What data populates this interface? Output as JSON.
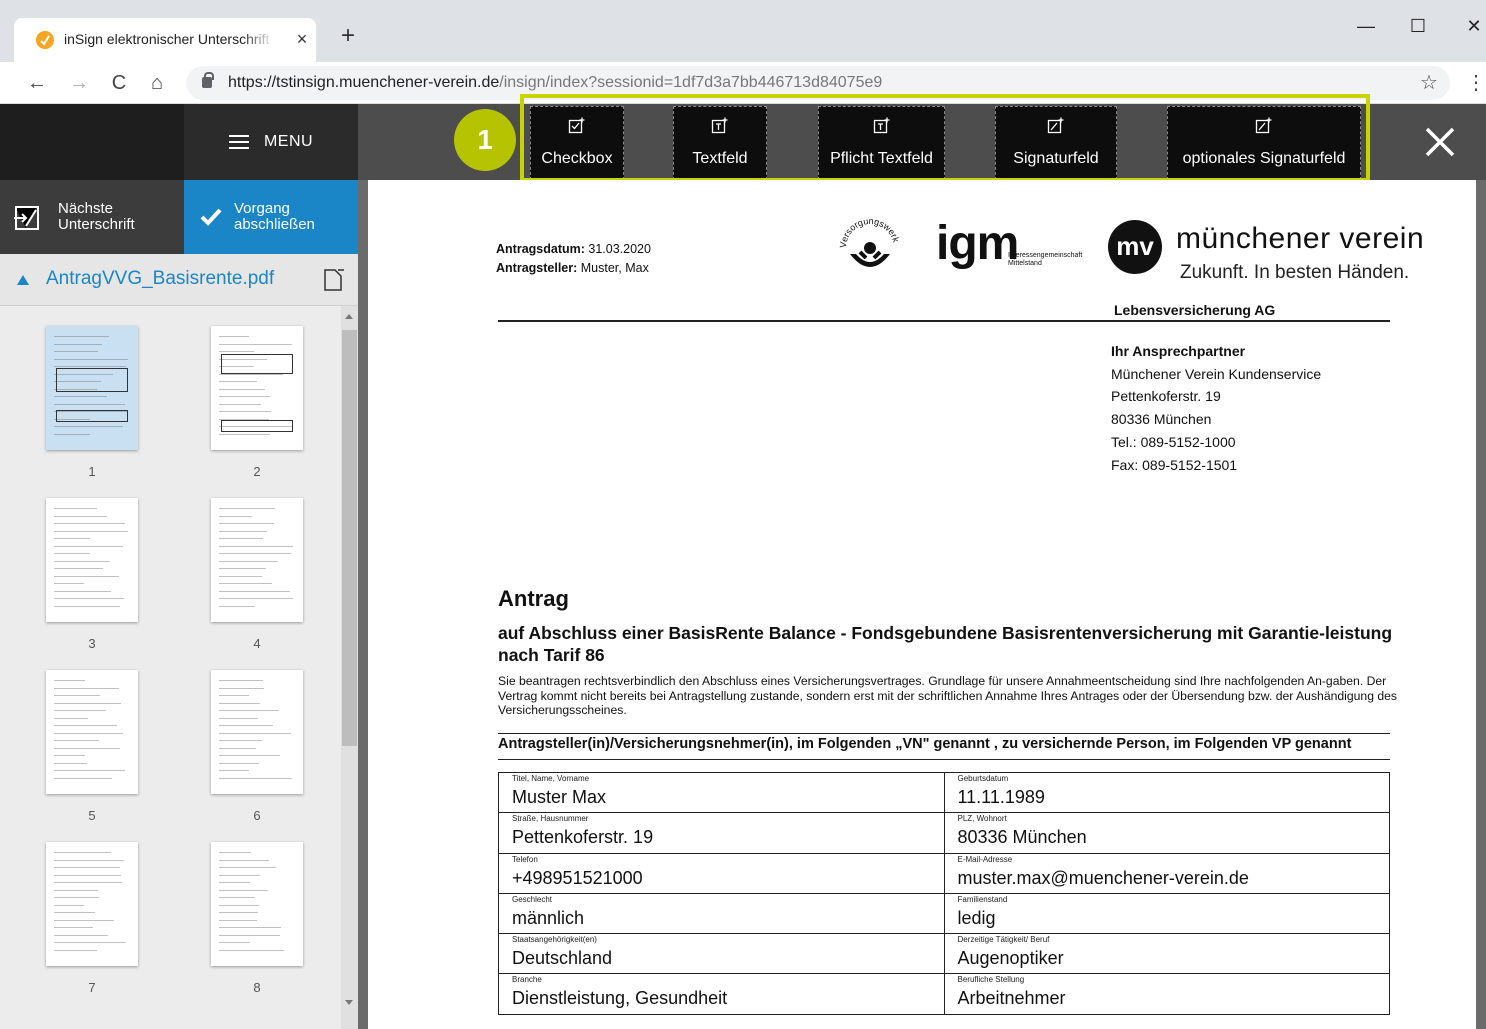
{
  "browser": {
    "tab_title": "inSign elektronischer Unterschrift",
    "tab_close": "×",
    "new_tab": "+",
    "url_host": "https://tstinsign.muenchener-verein.de",
    "url_path": "/insign/index?sessionid=1df7d3a7bb446713d84075e9",
    "nav": {
      "back": "←",
      "forward": "→",
      "reload": "C",
      "home": "⌂",
      "star": "☆",
      "more": "⋮"
    },
    "window": {
      "minimize": "—",
      "maximize": "☐",
      "close": "✕"
    }
  },
  "app": {
    "menu_label": "MENU",
    "next_signature": {
      "line1": "Nächste",
      "line2": "Unterschrift"
    },
    "finish": {
      "line1": "Vorgang",
      "line2": "abschließen"
    },
    "file_name": "AntragVVG_Basisrente.pdf",
    "accent_color": "#1a86c8",
    "highlight_color": "#c8d400",
    "badge_number": "1",
    "toolbar": [
      {
        "label": "Checkbox",
        "icon": "checkbox-add-icon"
      },
      {
        "label": "Textfeld",
        "icon": "textfield-add-icon"
      },
      {
        "label": "Pflicht Textfeld",
        "icon": "required-textfield-add-icon"
      },
      {
        "label": "Signaturfeld",
        "icon": "signature-field-add-icon"
      },
      {
        "label": "optionales Signaturfeld",
        "icon": "optional-signature-field-add-icon"
      }
    ],
    "thumbnails": {
      "pages": [
        "1",
        "2",
        "3",
        "4",
        "5",
        "6",
        "7",
        "8"
      ],
      "selected": "1"
    }
  },
  "document": {
    "date_label": "Antragsdatum:",
    "date_value": "31.03.2020",
    "applicant_label": "Antragsteller:",
    "applicant_value": "Muster, Max",
    "logo_vw_text": "Versorgungswerk",
    "logo_igm": "igm",
    "logo_igm_sub1": "Interessengemeinschaft",
    "logo_igm_sub2": "Mittelstand",
    "logo_mv_mark": "mv",
    "logo_mv_name": "münchener verein",
    "logo_mv_claim": "Zukunft. In besten Händen.",
    "company_unit": "Lebensversicherung AG",
    "contact": {
      "title": "Ihr Ansprechpartner",
      "lines": [
        "Münchener Verein Kundenservice",
        "Pettenkoferstr. 19",
        "80336 München",
        "Tel.: 089-5152-1000",
        "Fax: 089-5152-1501"
      ]
    },
    "title": "Antrag",
    "subtitle": "auf Abschluss einer BasisRente Balance - Fondsgebundene Basisrentenversicherung mit Garantie-leistung nach Tarif 86",
    "paragraph": "Sie beantragen rechtsverbindlich den Abschluss eines Versicherungsvertrages. Grundlage für unsere Annahmeentscheidung sind Ihre nachfolgenden An-gaben. Der Vertrag kommt nicht bereits bei Antragstellung zustande, sondern erst mit der schriftlichen Annahme Ihres Antrages oder der Übersendung bzw. der Aushändigung des Versicherungsscheines.",
    "section_heading": "Antragsteller(in)/Versicherungsnehmer(in), im Folgenden „VN\" genannt , zu versichernde Person, im Folgenden VP genannt",
    "form_rows": [
      [
        {
          "caption": "Titel, Name, Vorname",
          "value": "Muster Max"
        },
        {
          "caption": "Geburtsdatum",
          "value": "11.11.1989"
        }
      ],
      [
        {
          "caption": "Straße, Hausnummer",
          "value": "Pettenkoferstr. 19"
        },
        {
          "caption": "PLZ, Wohnort",
          "value": "80336 München"
        }
      ],
      [
        {
          "caption": "Telefon",
          "value": "+498951521000"
        },
        {
          "caption": "E-Mail-Adresse",
          "value": "muster.max@muenchener-verein.de"
        }
      ],
      [
        {
          "caption": "Geschlecht",
          "value": "männlich"
        },
        {
          "caption": "Familienstand",
          "value": "ledig"
        }
      ],
      [
        {
          "caption": "Staatsangehörigkeit(en)",
          "value": "Deutschland"
        },
        {
          "caption": "Derzeitige Tätigkeit/ Beruf",
          "value": "Augenoptiker"
        }
      ],
      [
        {
          "caption": "Branche",
          "value": "Dienstleistung, Gesundheit"
        },
        {
          "caption": "Berufliche Stellung",
          "value": "Arbeitnehmer"
        }
      ]
    ]
  }
}
